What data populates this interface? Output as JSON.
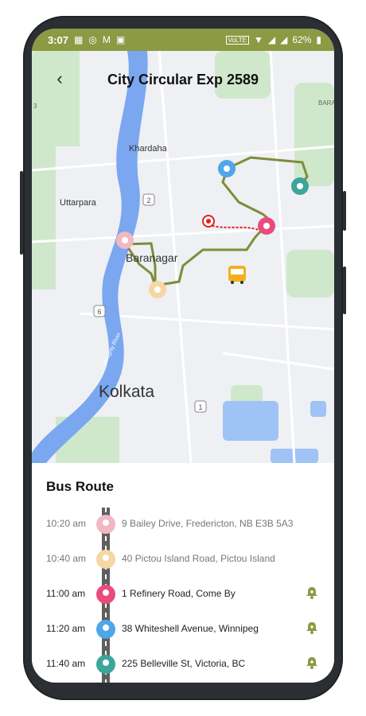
{
  "status_bar": {
    "time": "3:07",
    "battery": "62%",
    "network": "VoLTE"
  },
  "header": {
    "title": "City Circular Exp 2589",
    "back_icon": "back-arrow-icon"
  },
  "map": {
    "labels": {
      "khardaha": "Khardaha",
      "uttarpara": "Uttarpara",
      "baranagar": "Baranagar",
      "kolkata": "Kolkata",
      "hooghly": "Hooghly River",
      "shield_2": "2",
      "shield_6": "6",
      "shield_1": "1",
      "edge_right": "BARA",
      "edge_left": "3"
    }
  },
  "route": {
    "title": "Bus Route",
    "stops": [
      {
        "time": "10:20 am",
        "address": "9 Bailey Drive, Fredericton, NB E3B 5A3",
        "color": "#f1b8c3",
        "faded": true,
        "bell": false
      },
      {
        "time": "10:40 am",
        "address": "40 Pictou Island Road, Pictou Island",
        "color": "#f6d7a4",
        "faded": true,
        "bell": false
      },
      {
        "time": "11:00 am",
        "address": "1 Refinery Road, Come By",
        "color": "#ea4b7c",
        "faded": false,
        "bell": true
      },
      {
        "time": "11:20 am",
        "address": "38 Whiteshell Avenue, Winnipeg",
        "color": "#4fa6e8",
        "faded": false,
        "bell": true
      },
      {
        "time": "11:40 am",
        "address": "225 Belleville St, Victoria, BC",
        "color": "#3ca69a",
        "faded": false,
        "bell": true
      }
    ]
  },
  "colors": {
    "accent": "#8c9a44",
    "route_line": "#7e8c3a",
    "live_path": "#e02020"
  }
}
